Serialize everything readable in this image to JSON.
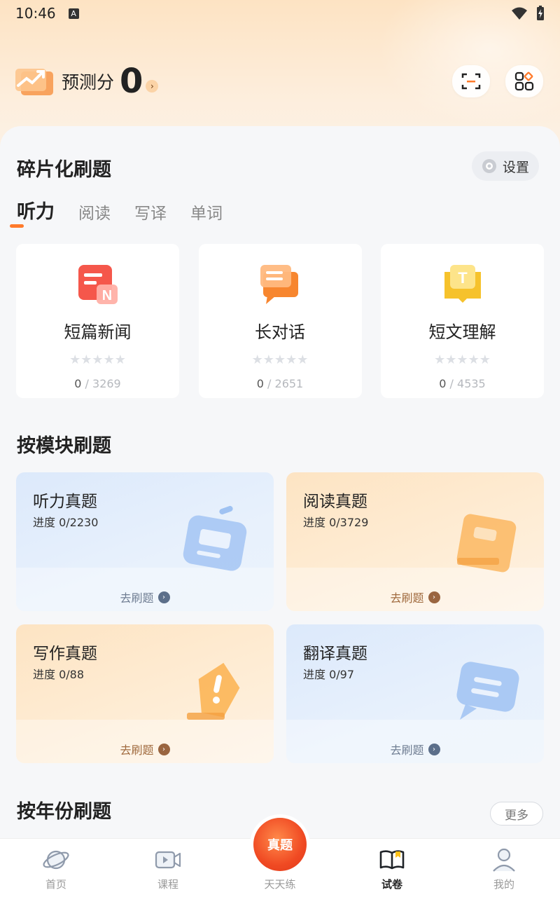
{
  "status_bar": {
    "time": "10:46",
    "input_badge": "A"
  },
  "header": {
    "score_label": "预测分",
    "score_value": "0",
    "arrow": "›"
  },
  "fragment": {
    "title": "碎片化刷题",
    "settings_label": "设置",
    "tabs": [
      "听力",
      "阅读",
      "写译",
      "单词"
    ],
    "cards": [
      {
        "title": "短篇新闻",
        "done": "0",
        "total": " / 3269",
        "icon": "news-icon"
      },
      {
        "title": "长对话",
        "done": "0",
        "total": " / 2651",
        "icon": "dialog-icon"
      },
      {
        "title": "短文理解",
        "done": "0",
        "total": " / 4535",
        "icon": "reading-icon"
      }
    ],
    "stars": "★★★★★"
  },
  "modules": {
    "title": "按模块刷题",
    "go_label": "去刷题",
    "items": [
      {
        "title": "听力真题",
        "progress": "进度 0/2230",
        "theme": "blue"
      },
      {
        "title": "阅读真题",
        "progress": "进度 0/3729",
        "theme": "orange"
      },
      {
        "title": "写作真题",
        "progress": "进度 0/88",
        "theme": "orange"
      },
      {
        "title": "翻译真题",
        "progress": "进度 0/97",
        "theme": "blue"
      }
    ]
  },
  "years": {
    "title": "按年份刷题",
    "more_label": "更多"
  },
  "nav": {
    "items": [
      "首页",
      "课程",
      "天天练",
      "试卷",
      "我的"
    ],
    "center_badge": "真题",
    "active": "试卷"
  },
  "colors": {
    "accent": "#ff7a2b",
    "blue_card": "#dce9fb",
    "orange_card": "#fde4c3"
  }
}
